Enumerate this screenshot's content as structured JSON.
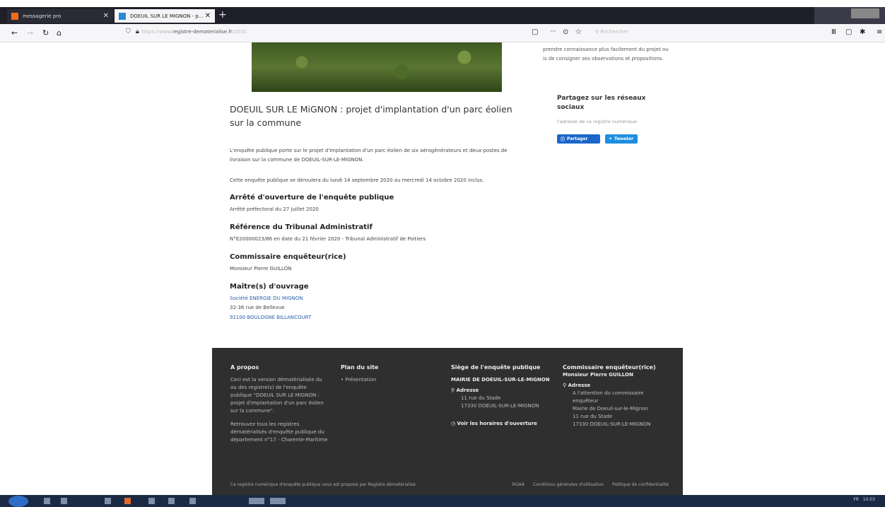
{
  "browser": {
    "tabs": [
      {
        "label": "messagerie pro",
        "active": false
      },
      {
        "label": "DOEUIL SUR LE MIGNON - p...",
        "active": true
      }
    ],
    "url_prefix": "https://www.",
    "url_main": "registre-dematerialise.fr",
    "url_suffix": "/2031",
    "search_placeholder": "Rechercher"
  },
  "sidebar": {
    "intro": "prendre connaissance plus facilement du projet ou is de consigner ses observations et propositions.",
    "share_title": "Partagez sur les réseaux sociaux",
    "share_sub": "l'adresse de ce registre numérique",
    "share_facebook": "Partager",
    "share_twitter": "Tweeter"
  },
  "content": {
    "title": "DOEUIL SUR LE MiGNON : projet d'implantation d'un parc éolien sur la commune",
    "desc": "L'enquête publique porte sur le projet d'implantation d'un parc éolien de six aérogénérateurs et deux postes de livraison sur la commune de DOEUIL-SUR-LE-MIGNON.",
    "dates": "Cette enquête publique se déroulera du lundi 14 septembre 2020 au mercredi 14 octobre 2020 inclus.",
    "arrete_title": "Arrêté d'ouverture de l'enquête publique",
    "arrete_value": "Arrêté préfectoral du 27 juillet 2020",
    "tribunal_title": "Référence du Tribunal Administratif",
    "tribunal_value": "N°E20000023/86 en date du 21 février 2020 - Tribunal Administratif de Poitiers",
    "commissaire_title": "Commissaire enquêteur(rice)",
    "commissaire_value": "Monsieur Pierre GUILLON",
    "maitre_title": "Maître(s) d'ouvrage",
    "maitre_company": "Société ENERGIE DU MIGNON",
    "maitre_address1": "32-36 rue de Bellevue",
    "maitre_address2": "92100 BOULOGNE BILLANCOURT"
  },
  "footer": {
    "apropos_title": "A propos",
    "apropos_text1": "Ceci est la version dématérialisée du ou des registre(s) de l'enquête publique \"DOEUIL SUR LE MIGNON : projet d'implantation d'un parc éolien sur la commune\".",
    "apropos_text2": "Retrouvez tous les registres dématérialisés d'enquête publique du département n°17 - Charente-Maritime",
    "plan_title": "Plan du site",
    "plan_item": "Présentation",
    "siege_title": "Siège de l'enquête publique",
    "siege_name": "MAIRIE DE DOEUIL-SUR-LE-MIGNON",
    "siege_addr_label": "Adresse",
    "siege_addr1": "11 rue du Stade",
    "siege_addr2": "17330 DOEUIL-SUR-LE-MIGNON",
    "siege_hours": "Voir les horaires d'ouverture",
    "comm_title": "Commissaire enquêteur(rice)",
    "comm_name": "Monsieur Pierre GUILLON",
    "comm_addr_label": "Adresse",
    "comm_addr1": "A l'attention du commissaire enquêteur",
    "comm_addr2": "Mairie de Doeuil-sur-le-Mignon",
    "comm_addr3": "11 rue du Stade",
    "comm_addr4": "17330 DOEUIL-SUR-LE-MIGNON",
    "bottom_text": "Ce registre numérique d'enquête publique vous est proposé par Registre dématérialisé.",
    "bottom_links": [
      "RGAA",
      "Conditions générales d'utilisation",
      "Politique de confidentialité"
    ]
  },
  "taskbar": {
    "clock": "10:03",
    "lang": "FR"
  }
}
